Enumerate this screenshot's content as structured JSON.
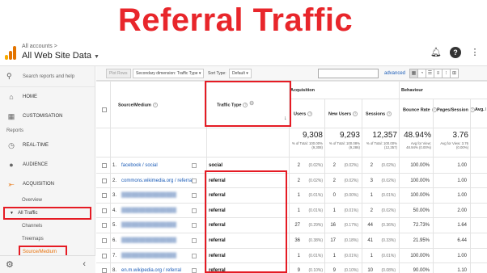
{
  "banner": {
    "title": "Referral Traffic"
  },
  "colors": {
    "accent": "#e8262b",
    "link": "#1a5bb7",
    "highlight": "#e51b24",
    "active_item": "#e8710a"
  },
  "header": {
    "account_small": "All accounts",
    "account_name": "All Web Site Data",
    "icons": [
      "bell-icon",
      "help-icon",
      "more-icon"
    ]
  },
  "sidebar": {
    "search_label": "Search reports and help",
    "items": [
      {
        "label": "HOME",
        "icon": "home-icon"
      },
      {
        "label": "CUSTOMISATION",
        "icon": "grid-icon"
      }
    ],
    "section_label": "Reports",
    "report_items": [
      {
        "label": "REAL-TIME",
        "icon": "clock-icon"
      },
      {
        "label": "AUDIENCE",
        "icon": "person-icon"
      },
      {
        "label": "ACQUISITION",
        "icon": "acquisition-icon"
      }
    ],
    "sub_items": {
      "overview": "Overview",
      "all_traffic": "All Traffic",
      "channels": "Channels",
      "treemaps": "Treemaps",
      "source_medium": "Source/Medium"
    }
  },
  "toolbar": {
    "plot_rows": "Plot Rows",
    "secondary_dimension": "Secondary dimension: Traffic Type",
    "sort_type_label": "Sort Type:",
    "sort_type_value": "Default",
    "advanced": "advanced"
  },
  "table": {
    "group_acquisition": "Acquisition",
    "group_behaviour": "Behaviour",
    "headers": {
      "source_medium": "Source/Medium",
      "traffic_type": "Traffic Type",
      "users": "Users",
      "new_users": "New Users",
      "sessions": "Sessions",
      "bounce_rate": "Bounce Rate",
      "pages_session": "Pages/Session",
      "avg_dur": "Avg. Dur"
    },
    "totals": {
      "users": "9,308",
      "users_sub": "% of Total: 100.00% (9,308)",
      "new_users": "9,293",
      "new_users_sub": "% of Total: 100.08% (9,286)",
      "sessions": "12,357",
      "sessions_sub": "% of Total: 100.00% (12,357)",
      "bounce_rate": "48.94%",
      "bounce_rate_sub": "Avg for View: 48.94% (0.00%)",
      "pages_session": "3.76",
      "pages_session_sub": "Avg for View: 3.76 (0.00%)"
    },
    "rows": [
      {
        "num": "1.",
        "source": "facebook / social",
        "blurred": false,
        "type": "social",
        "users": "2",
        "users_pct": "(0.02%)",
        "new_users": "2",
        "new_users_pct": "(0.02%)",
        "sessions": "2",
        "sessions_pct": "(0.02%)",
        "bounce": "100.00%",
        "pages": "1.00"
      },
      {
        "num": "2.",
        "source": "commons.wikimedia.org / referral",
        "blurred": false,
        "type": "referral",
        "users": "2",
        "users_pct": "(0.02%)",
        "new_users": "2",
        "new_users_pct": "(0.02%)",
        "sessions": "3",
        "sessions_pct": "(0.02%)",
        "bounce": "100.00%",
        "pages": "1.00"
      },
      {
        "num": "3.",
        "source": "",
        "blurred": true,
        "type": "referral",
        "users": "1",
        "users_pct": "(0.01%)",
        "new_users": "0",
        "new_users_pct": "(0.00%)",
        "sessions": "1",
        "sessions_pct": "(0.01%)",
        "bounce": "100.00%",
        "pages": "1.00"
      },
      {
        "num": "4.",
        "source": "",
        "blurred": true,
        "type": "referral",
        "users": "1",
        "users_pct": "(0.01%)",
        "new_users": "1",
        "new_users_pct": "(0.01%)",
        "sessions": "2",
        "sessions_pct": "(0.02%)",
        "bounce": "50.00%",
        "pages": "2.00"
      },
      {
        "num": "5.",
        "source": "",
        "blurred": true,
        "type": "referral",
        "users": "27",
        "users_pct": "(0.29%)",
        "new_users": "16",
        "new_users_pct": "(0.17%)",
        "sessions": "44",
        "sessions_pct": "(0.36%)",
        "bounce": "72.73%",
        "pages": "1.64"
      },
      {
        "num": "6.",
        "source": "",
        "blurred": true,
        "type": "referral",
        "users": "36",
        "users_pct": "(0.38%)",
        "new_users": "17",
        "new_users_pct": "(0.18%)",
        "sessions": "41",
        "sessions_pct": "(0.33%)",
        "bounce": "21.95%",
        "pages": "6.44"
      },
      {
        "num": "7.",
        "source": "",
        "blurred": true,
        "type": "referral",
        "users": "1",
        "users_pct": "(0.01%)",
        "new_users": "1",
        "new_users_pct": "(0.01%)",
        "sessions": "1",
        "sessions_pct": "(0.01%)",
        "bounce": "100.00%",
        "pages": "1.00"
      },
      {
        "num": "8.",
        "source": "en.m.wikipedia.org / referral",
        "blurred": false,
        "type": "referral",
        "users": "9",
        "users_pct": "(0.10%)",
        "new_users": "9",
        "new_users_pct": "(0.10%)",
        "sessions": "10",
        "sessions_pct": "(0.08%)",
        "bounce": "90.00%",
        "pages": "1.10"
      }
    ]
  }
}
